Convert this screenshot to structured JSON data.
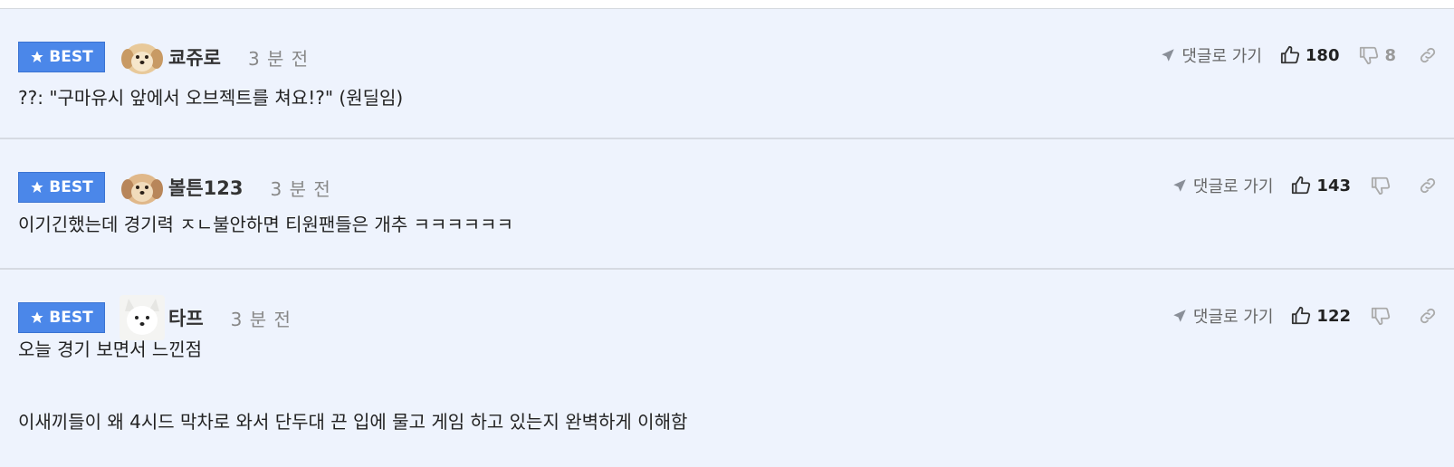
{
  "comments": [
    {
      "badge": "BEST",
      "author": "쿄쥬로",
      "time": "3 분 전",
      "goto_label": "댓글로 가기",
      "likes": "180",
      "dislikes": "8",
      "text": [
        "??: \"구마유시 앞에서 오브젝트를 쳐요!?\" (원딜임)"
      ]
    },
    {
      "badge": "BEST",
      "author": "볼튼123",
      "time": "3 분 전",
      "goto_label": "댓글로 가기",
      "likes": "143",
      "dislikes": "",
      "text": [
        "이기긴했는데 경기력 ㅈㄴ불안하면 티원팬들은 개추 ㅋㅋㅋㅋㅋㅋ"
      ]
    },
    {
      "badge": "BEST",
      "author": "타프",
      "time": "3 분 전",
      "goto_label": "댓글로 가기",
      "likes": "122",
      "dislikes": "",
      "text": [
        "오늘 경기 보면서 느낀점",
        "이새끼들이 왜 4시드 막차로 와서 단두대 끈 입에 물고 게임 하고 있는지 완벽하게 이해함"
      ]
    }
  ],
  "colors": {
    "background": "#eef3fd",
    "badge": "#4b87e9"
  },
  "icons": [
    "star-icon",
    "send-arrow-icon",
    "thumbs-up-icon",
    "thumbs-down-icon",
    "link-icon"
  ]
}
